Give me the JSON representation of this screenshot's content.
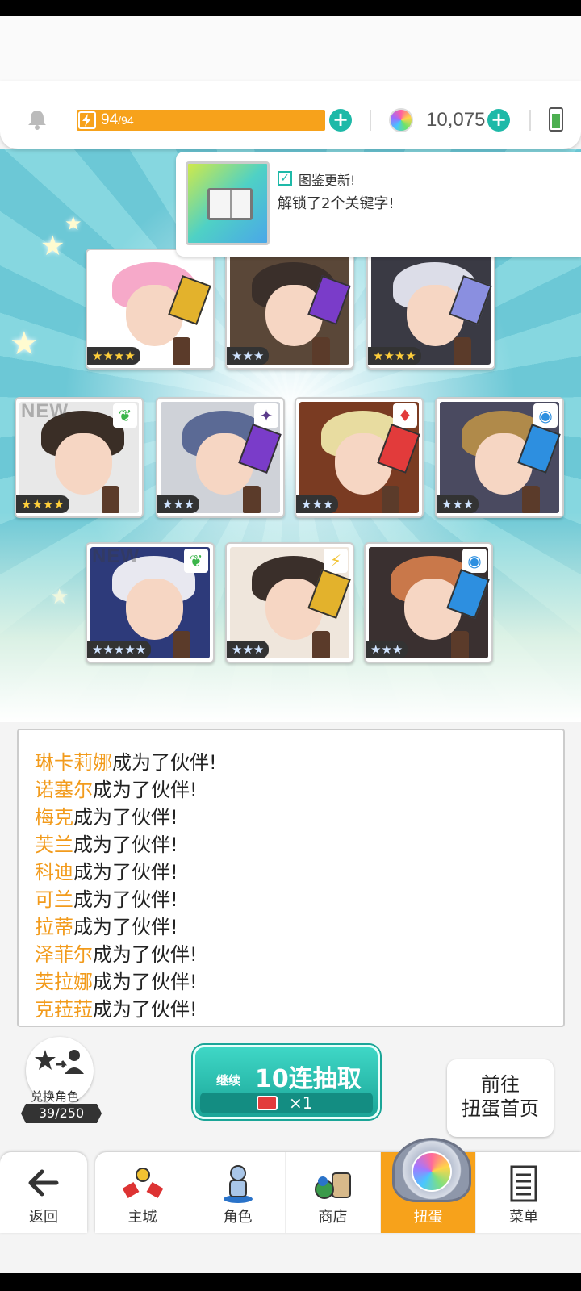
{
  "hud": {
    "energy_current": "94",
    "energy_max": "/94",
    "gems": "10,075",
    "icons": [
      "bell-icon",
      "bolt-icon",
      "plus-icon",
      "gem-icon",
      "battery-icon"
    ]
  },
  "notice": {
    "title": "图鉴更新!",
    "body": "解锁了2个关键字!"
  },
  "cards": [
    {
      "rarity": "★★★★",
      "silver": false,
      "element": "",
      "new": false,
      "hair": "#f6a9c9",
      "bg": "#ffffff",
      "crystal": "#e3b22c"
    },
    {
      "rarity": "★★★",
      "silver": true,
      "element": "",
      "new": false,
      "hair": "#3a2f2a",
      "bg": "#5a4738",
      "crystal": "#7a3cc9"
    },
    {
      "rarity": "★★★★",
      "silver": false,
      "element": "",
      "new": false,
      "hair": "#dcdde8",
      "bg": "#3a3a44",
      "crystal": "#8a8fe0"
    },
    {
      "rarity": "★★★★",
      "silver": false,
      "element": "leaf",
      "new": true,
      "hair": "#3a2e26",
      "bg": "#e8e8e8",
      "crystal": ""
    },
    {
      "rarity": "★★★",
      "silver": true,
      "element": "dark",
      "new": false,
      "hair": "#5b6a95",
      "bg": "#cfd2d8",
      "crystal": "#7a3cc9"
    },
    {
      "rarity": "★★★",
      "silver": true,
      "element": "fire",
      "new": false,
      "hair": "#e8dca0",
      "bg": "#7a3b22",
      "crystal": "#e23b3b"
    },
    {
      "rarity": "★★★",
      "silver": true,
      "element": "water",
      "new": false,
      "hair": "#b08a4a",
      "bg": "#4a4a60",
      "crystal": "#2d8fe0"
    },
    {
      "rarity": "★★★★★",
      "silver": true,
      "element": "leaf",
      "new": true,
      "hair": "#e8e8f0",
      "bg": "#2d3a7a",
      "crystal": ""
    },
    {
      "rarity": "★★★",
      "silver": true,
      "element": "thunder",
      "new": false,
      "hair": "#3a2f2a",
      "bg": "#efe6dc",
      "crystal": "#e3b22c"
    },
    {
      "rarity": "★★★",
      "silver": true,
      "element": "water",
      "new": false,
      "hair": "#c9784a",
      "bg": "#3a3030",
      "crystal": "#2d8fe0"
    }
  ],
  "log": [
    {
      "name": "琳卡莉娜",
      "text": "成为了伙伴!"
    },
    {
      "name": "诺塞尔",
      "text": "成为了伙伴!"
    },
    {
      "name": "梅克",
      "text": "成为了伙伴!"
    },
    {
      "name": "芙兰",
      "text": "成为了伙伴!"
    },
    {
      "name": "科迪",
      "text": "成为了伙伴!"
    },
    {
      "name": "可兰",
      "text": "成为了伙伴!"
    },
    {
      "name": "拉蒂",
      "text": "成为了伙伴!"
    },
    {
      "name": "泽菲尔",
      "text": "成为了伙伴!"
    },
    {
      "name": "芙拉娜",
      "text": "成为了伙伴!"
    },
    {
      "name": "克菈菈",
      "text": "成为了伙伴!"
    }
  ],
  "exchange": {
    "label": "兑换角色",
    "count": "39/250"
  },
  "pull": {
    "prefix": "继续",
    "label": "10连抽取",
    "cost": "×1"
  },
  "goto": {
    "line1": "前往",
    "line2": "扭蛋首页"
  },
  "nav": {
    "back": "返回",
    "tabs": [
      "主城",
      "角色",
      "商店",
      "扭蛋",
      "菜单"
    ],
    "active": "扭蛋"
  },
  "colors": {
    "accent": "#1eb9a8",
    "energy": "#f7a21b",
    "name_highlight": "#f29b1c"
  }
}
